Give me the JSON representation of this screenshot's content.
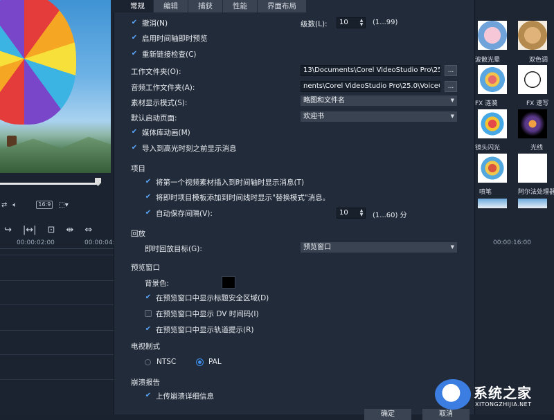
{
  "tabs": [
    "常规",
    "编辑",
    "捕获",
    "性能",
    "界面布局"
  ],
  "general": {
    "undo": {
      "label": "撤消(N)",
      "checked": true
    },
    "undo_levels_label": "级数(L):",
    "undo_levels_value": "10",
    "undo_levels_range": "(1...99)",
    "instant_timeline_preview": {
      "label": "启用时间轴即时预览",
      "checked": true
    },
    "relink_check": {
      "label": "重新链接检查(C)",
      "checked": true
    },
    "working_folder_label": "工作文件夹(O):",
    "working_folder_value": "13\\Documents\\Corel VideoStudio Pro\\25.0\\",
    "audio_folder_label": "音频工作文件夹(A):",
    "audio_folder_value": "nents\\Corel VideoStudio Pro\\25.0\\VoiceOver\\",
    "browse_label": "...",
    "clip_display_label": "素材显示模式(S):",
    "clip_display_value": "略图和文件名",
    "default_page_label": "默认启动页面:",
    "default_page_value": "欢迎书",
    "library_animation": {
      "label": "媒体库动画(M)",
      "checked": true
    },
    "show_highlight_msg": {
      "label": "导入到高光时刻之前显示消息",
      "checked": true
    }
  },
  "project": {
    "title": "项目",
    "insert_msg": {
      "label": "将第一个视频素材插入到时间轴时显示消息(T)",
      "checked": true
    },
    "replace_msg": {
      "label": "将即时项目模板添加到时间线时显示\"替换模式\"消息。",
      "checked": true
    },
    "autosave": {
      "label": "自动保存间隔(V):",
      "checked": true
    },
    "autosave_value": "10",
    "autosave_range": "(1...60) 分"
  },
  "playback": {
    "title": "回放",
    "target_label": "即时回放目标(G):",
    "target_value": "预览窗口"
  },
  "preview_window": {
    "title": "预览窗口",
    "bg_color_label": "背景色:",
    "bg_color": "#000000",
    "safe_area": {
      "label": "在预览窗口中显示标题安全区域(D)",
      "checked": true
    },
    "dv_timecode": {
      "label": "在预览窗口中显示 DV 时间码(I)",
      "checked": false
    },
    "track_hint": {
      "label": "在预览窗口中显示轨道提示(R)",
      "checked": true
    }
  },
  "tv_system": {
    "title": "电视制式",
    "options": [
      "NTSC",
      "PAL"
    ],
    "selected": "PAL"
  },
  "crash_report": {
    "title": "崩溃报告",
    "upload": {
      "label": "上传崩溃详细信息",
      "checked": true
    }
  },
  "footer": {
    "ok": "确定",
    "cancel": "取消"
  },
  "timeline": {
    "ticks": [
      "00:00:02:00",
      "00:00:04:",
      "00:00:16:00"
    ]
  },
  "effects": [
    {
      "label": "波散光晕"
    },
    {
      "label": "双色调"
    },
    {
      "label": "FX 涟漪"
    },
    {
      "label": "FX 速写"
    },
    {
      "label": "镜头闪光"
    },
    {
      "label": "光线"
    },
    {
      "label": "喷笔"
    },
    {
      "label": "阿尔法处理器"
    }
  ],
  "watermark": {
    "name": "系统之家",
    "url": "XITONGZHIJIA.NET"
  },
  "colors": {
    "accent": "#3f8ef0",
    "dialog_bg": "#222b39",
    "tab_active": "#1b2331"
  }
}
